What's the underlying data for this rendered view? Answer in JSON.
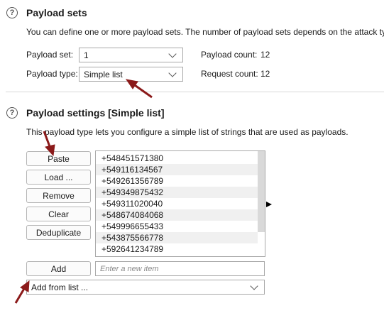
{
  "payload_sets": {
    "title": "Payload sets",
    "description": "You can define one or more payload sets. The number of payload sets depends on the attack type",
    "set_label": "Payload set:",
    "set_value": "1",
    "type_label": "Payload type:",
    "type_value": "Simple list",
    "count_label": "Payload count:",
    "count_value": "12",
    "request_label": "Request count:",
    "request_value": "12"
  },
  "payload_settings": {
    "title": "Payload settings [Simple list]",
    "description": "This payload type lets you configure a simple list of strings that are used as payloads.",
    "buttons": {
      "paste": "Paste",
      "load": "Load ...",
      "remove": "Remove",
      "clear": "Clear",
      "deduplicate": "Deduplicate",
      "add": "Add"
    },
    "items": [
      "+548451571380",
      "+549116134567",
      "+549261356789",
      "+549349875432",
      "+549311020040",
      "+548674084068",
      "+549996655433",
      "+543875566778",
      "+592641234789"
    ],
    "new_item_placeholder": "Enter a new item",
    "add_from_list": "Add from list ..."
  },
  "icons": {
    "help": "question-circle-icon",
    "expand": "triangle-right-icon",
    "annotation": "red-arrow-icon"
  },
  "colors": {
    "annotation_arrow": "#8b1a1a",
    "row_alt": "#f0f0f0"
  }
}
